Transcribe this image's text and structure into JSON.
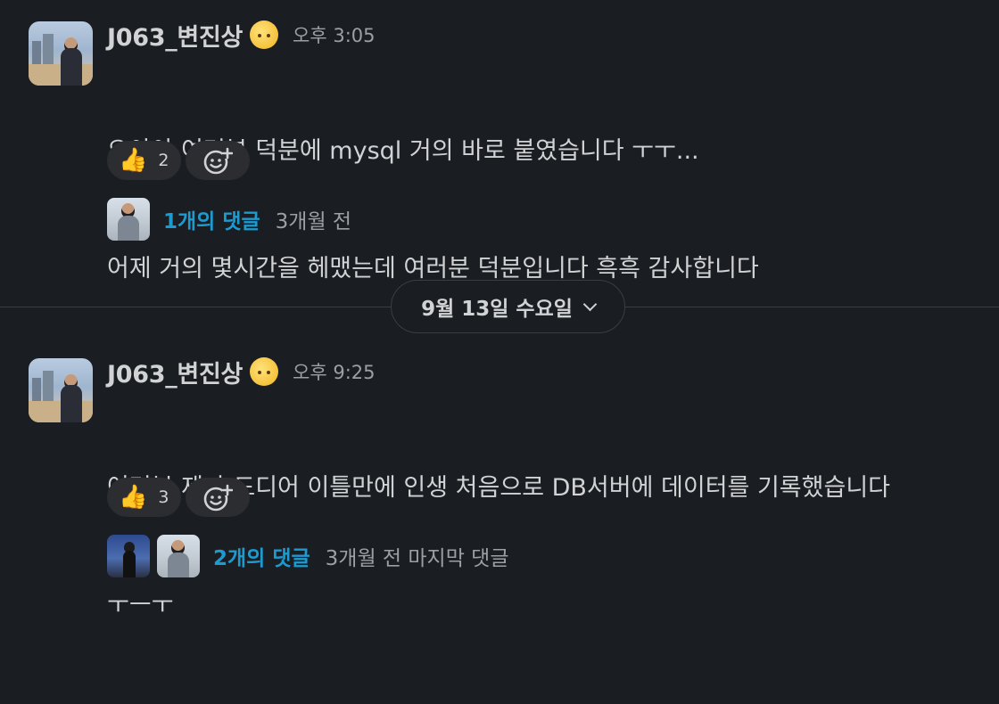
{
  "messages": [
    {
      "author": "J063_변진상",
      "time": "오후 3:05",
      "lines": [
        "으아아 여러분 덕분에 mysql 거의 바로 붙였습니다 ㅜㅜ...",
        "어제 거의 몇시간을 헤맸는데 여러분 덕분입니다 흑흑 감사합니다"
      ],
      "reactions": [
        {
          "emoji": "👍",
          "icon": "thumbs-up-icon",
          "count": "2"
        }
      ],
      "add_reaction_icon": "add-reaction-icon",
      "replies": {
        "count_label": "1개의 댓글",
        "meta": "3개월 전"
      }
    },
    {
      "author": "J063_변진상",
      "time": "오후 9:25",
      "lines": [
        "여러분 제가 드디어 이틀만에 인생 처음으로 DB서버에 데이터를 기록했습니다",
        "ㅜㅡㅜ"
      ],
      "reactions": [
        {
          "emoji": "👍",
          "icon": "thumbs-up-icon",
          "count": "3"
        }
      ],
      "add_reaction_icon": "add-reaction-icon",
      "replies": {
        "count_label": "2개의 댓글",
        "meta": "3개월 전 마지막 댓글"
      }
    }
  ],
  "date_divider": {
    "label": "9월 13일 수요일",
    "icon": "chevron-down-icon"
  },
  "colors": {
    "background": "#1a1d21",
    "link": "#1d9bd1",
    "pill": "#2b2d31"
  }
}
